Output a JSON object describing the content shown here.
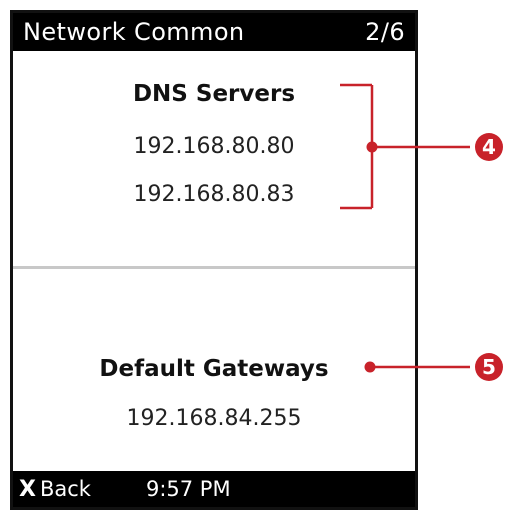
{
  "header": {
    "title": "Network Common",
    "page_indicator": "2/6"
  },
  "dns": {
    "label": "DNS Servers",
    "servers": [
      "192.168.80.80",
      "192.168.80.83"
    ]
  },
  "gateway": {
    "label": "Default Gateways",
    "addresses": [
      "192.168.84.255"
    ]
  },
  "footer": {
    "back_glyph": "X",
    "back_label": "Back",
    "time": "9:57 PM"
  },
  "callouts": [
    {
      "number": "4",
      "target": "DNS Servers"
    },
    {
      "number": "5",
      "target": "Default Gateways"
    }
  ],
  "colors": {
    "bar_background": "#000000",
    "bar_text": "#ffffff",
    "callout": "#c8222a",
    "divider": "#c8c8c8"
  }
}
